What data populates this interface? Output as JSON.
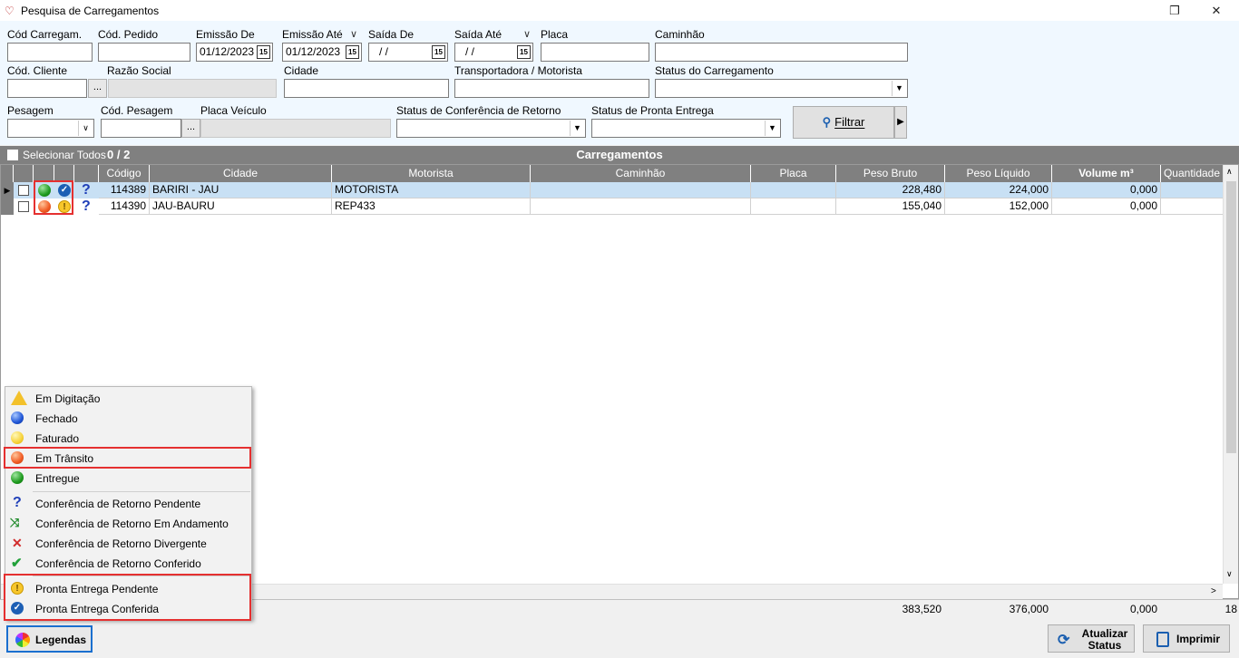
{
  "window": {
    "title": "Pesquisa de Carregamentos",
    "restore_glyph": "❐",
    "close_glyph": "✕"
  },
  "filters": {
    "cod_carregam_label": "Cód Carregam.",
    "cod_carregam_value": "",
    "cod_pedido_label": "Cód. Pedido",
    "cod_pedido_value": "",
    "emissao_de_label": "Emissão De",
    "emissao_de_value": "01/12/2023",
    "emissao_ate_label": "Emissão Até",
    "emissao_ate_value": "01/12/2023",
    "saida_de_label": "Saída De",
    "saida_de_value": "/ /",
    "saida_ate_label": "Saída Até",
    "saida_ate_value": "/ /",
    "placa_label": "Placa",
    "placa_value": "",
    "caminhao_label": "Caminhão",
    "caminhao_value": "",
    "cod_cliente_label": "Cód. Cliente",
    "cod_cliente_value": "",
    "razao_social_label": "Razão Social",
    "razao_social_value": "",
    "cidade_label": "Cidade",
    "cidade_value": "",
    "transportadora_label": "Transportadora / Motorista",
    "transportadora_value": "",
    "status_carregamento_label": "Status do Carregamento",
    "status_carregamento_value": "",
    "pesagem_label": "Pesagem",
    "pesagem_value": "",
    "cod_pesagem_label": "Cód. Pesagem",
    "cod_pesagem_value": "",
    "placa_veiculo_label": "Placa Veículo",
    "placa_veiculo_value": "",
    "status_conferencia_label": "Status de Conferência de Retorno",
    "status_conferencia_value": "",
    "status_pronta_entrega_label": "Status de Pronta Entrega",
    "status_pronta_entrega_value": "",
    "ellipsis": "...",
    "calendar_glyph": "15",
    "filtrar_label": "Filtrar"
  },
  "grid": {
    "select_all_label": "Selecionar Todos",
    "count": "0 / 2",
    "title": "Carregamentos",
    "columns": [
      "Código",
      "Cidade",
      "Motorista",
      "Caminhão",
      "Placa",
      "Peso Bruto",
      "Peso Líquido",
      "Volume m³",
      "Quantidade"
    ],
    "rows": [
      {
        "codigo": "114389",
        "cidade": "BARIRI - JAU",
        "motorista": "MOTORISTA",
        "caminhao": "",
        "placa": "",
        "peso_bruto": "228,480",
        "peso_liquido": "224,000",
        "volume": "0,000",
        "quantidade": "",
        "status": "green",
        "pronta": "check",
        "conferencia": "?"
      },
      {
        "codigo": "114390",
        "cidade": "JAU-BAURU",
        "motorista": "REP433",
        "caminhao": "",
        "placa": "",
        "peso_bruto": "155,040",
        "peso_liquido": "152,000",
        "volume": "0,000",
        "quantidade": "",
        "status": "orange",
        "pronta": "warn",
        "conferencia": "?"
      }
    ],
    "totals": {
      "peso_bruto": "383,520",
      "peso_liquido": "376,000",
      "volume": "0,000",
      "quantidade": "18"
    }
  },
  "legend": {
    "items": [
      {
        "label": "Em Digitação",
        "icon": "warning-icon"
      },
      {
        "label": "Fechado",
        "icon": "blue-ball-icon"
      },
      {
        "label": "Faturado",
        "icon": "yellow-ball-icon"
      },
      {
        "label": "Em Trânsito",
        "icon": "orange-ball-icon"
      },
      {
        "label": "Entregue",
        "icon": "green-ball-icon"
      },
      {
        "label": "Conferência de Retorno Pendente",
        "icon": "question-icon"
      },
      {
        "label": "Conferência de Retorno Em Andamento",
        "icon": "arrows-in-icon"
      },
      {
        "label": "Conferência de Retorno Divergente",
        "icon": "x-icon"
      },
      {
        "label": "Conferência de Retorno Conferido",
        "icon": "checkmark-icon"
      },
      {
        "label": "Pronta Entrega Pendente",
        "icon": "exclamation-icon"
      },
      {
        "label": "Pronta Entrega Conferida",
        "icon": "check-circle-icon"
      }
    ]
  },
  "buttons": {
    "legendas": "Legendas",
    "atualizar_status": "Atualizar Status",
    "imprimir": "Imprimir"
  },
  "colors": {
    "filter_bg": "#f0f8ff",
    "header_gray": "#808080",
    "selected_row": "#c8e0f4",
    "highlight_red": "#e53030",
    "accent_blue": "#1b5fb0"
  }
}
